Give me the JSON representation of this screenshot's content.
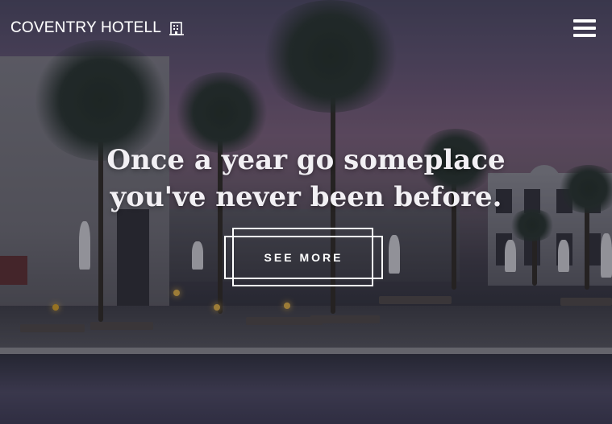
{
  "header": {
    "brand_name": "COVENTRY HOTELL",
    "brand_icon": "building-icon",
    "menu_icon": "hamburger-menu-icon"
  },
  "hero": {
    "headline_line1": "Once a year go someplace",
    "headline_line2": "you've never been before.",
    "cta_label": "SEE MORE",
    "background_image": "resort-pool-palm-trees-dusk"
  },
  "colors": {
    "text": "#ffffff",
    "sky_top": "#4a4660",
    "sky_mid": "#7a5e78"
  }
}
